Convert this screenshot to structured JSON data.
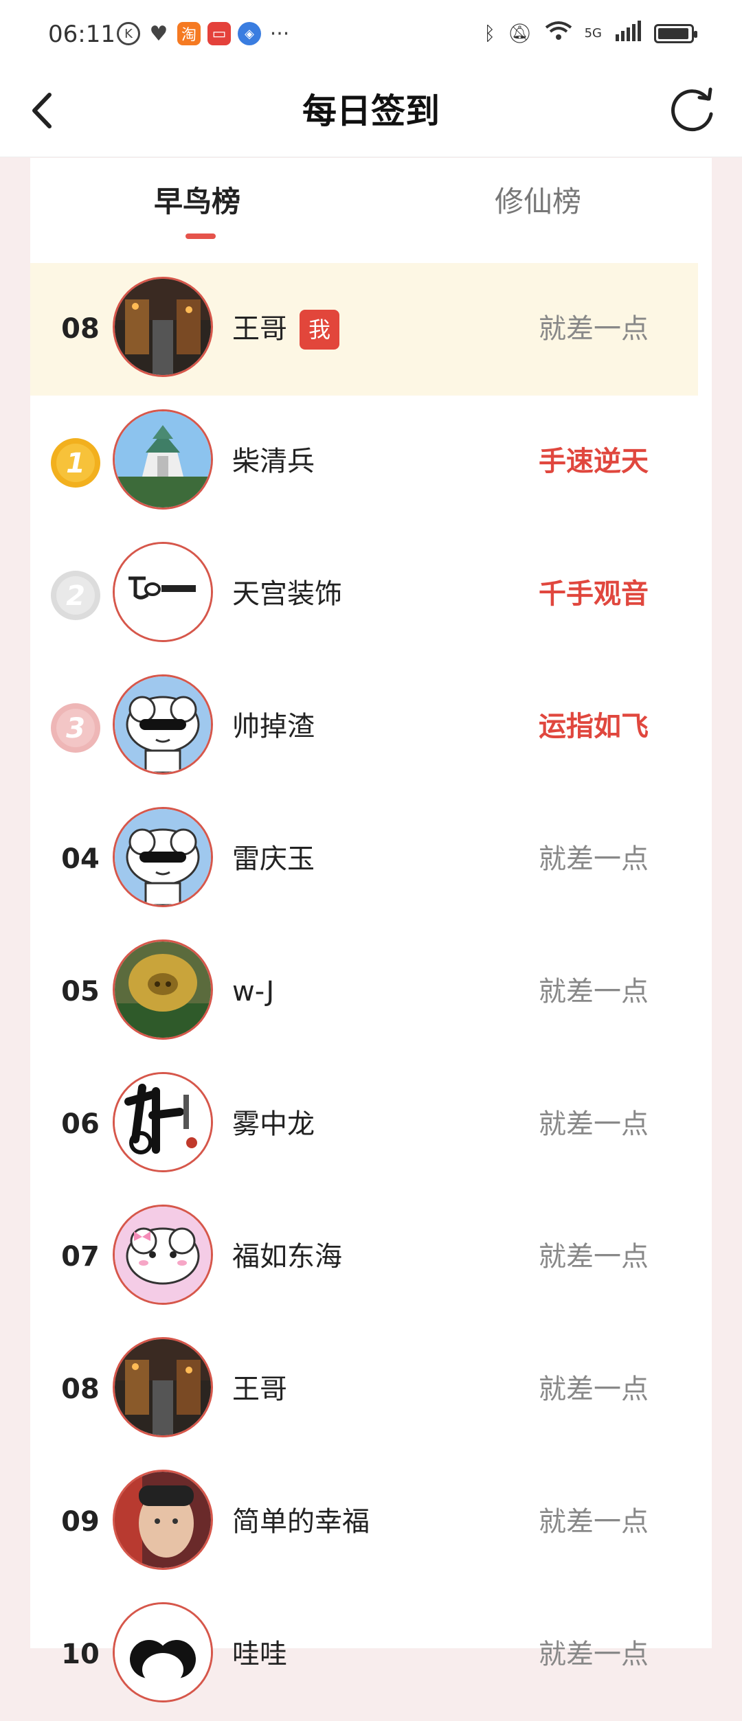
{
  "statusbar": {
    "time": "06:11",
    "taobao": "淘",
    "network": "5G"
  },
  "header": {
    "title": "每日签到"
  },
  "tabs": [
    {
      "label": "早鸟榜"
    },
    {
      "label": "修仙榜"
    }
  ],
  "my_row": {
    "rank": "08",
    "name": "王哥",
    "badge": "我",
    "status": "就差一点"
  },
  "rows": [
    {
      "rank": "1",
      "name": "柴清兵",
      "status": "手速逆天"
    },
    {
      "rank": "2",
      "name": "天宫装饰",
      "status": "千手观音"
    },
    {
      "rank": "3",
      "name": "帅掉渣",
      "status": "运指如飞"
    },
    {
      "rank": "04",
      "name": "雷庆玉",
      "status": "就差一点"
    },
    {
      "rank": "05",
      "name": "w-J",
      "status": "就差一点"
    },
    {
      "rank": "06",
      "name": "雾中龙",
      "status": "就差一点"
    },
    {
      "rank": "07",
      "name": "福如东海",
      "status": "就差一点"
    },
    {
      "rank": "08",
      "name": "王哥",
      "status": "就差一点"
    },
    {
      "rank": "09",
      "name": "简单的幸福",
      "status": "就差一点"
    },
    {
      "rank": "10",
      "name": "哇哇",
      "status": "就差一点"
    }
  ],
  "colors": {
    "accent": "#e2463b",
    "highlight_row": "#fdf7e4",
    "gold": "#f2b01e",
    "silver": "#d9d9d9",
    "bronze": "#eeb6b6"
  }
}
